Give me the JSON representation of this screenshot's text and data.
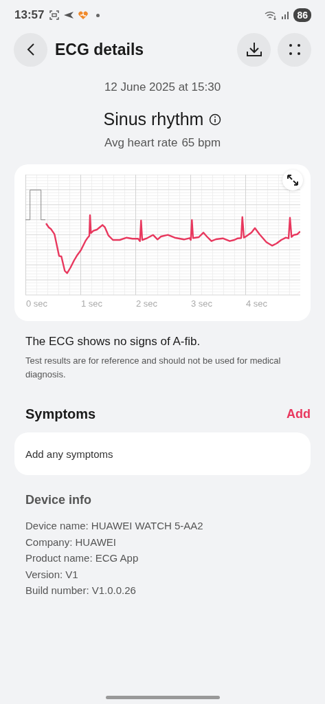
{
  "status_bar": {
    "time": "13:57",
    "battery": "86"
  },
  "header": {
    "title": "ECG details"
  },
  "date": "12 June 2025 at 15:30",
  "result": {
    "title": "Sinus rhythm",
    "avg_label": "Avg heart rate",
    "avg_value": "65 bpm"
  },
  "ecg": {
    "axis_labels": [
      "0 sec",
      "1 sec",
      "2 sec",
      "3 sec",
      "4 sec"
    ]
  },
  "summary": "The ECG shows no signs of A-fib.",
  "disclaimer": "Test results are for reference and should not be used for medical diagnosis.",
  "symptoms": {
    "title": "Symptoms",
    "action": "Add",
    "entry_label": "Add any symptoms"
  },
  "device_info": {
    "title": "Device info",
    "lines": [
      "Device name: HUAWEI WATCH 5-AA2",
      "Company: HUAWEI",
      "Product name: ECG App",
      "Version: V1",
      "Build number: V1.0.0.26"
    ]
  }
}
